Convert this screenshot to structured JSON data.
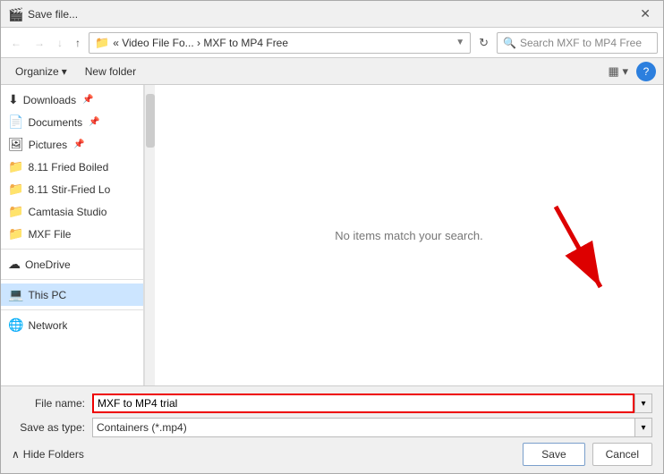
{
  "window": {
    "title": "Save file...",
    "icon": "🎬"
  },
  "nav": {
    "back_disabled": true,
    "forward_disabled": true,
    "up_disabled": false,
    "address_folder_icon": "📁",
    "address_path": "« Video File Fo... › MXF to MP4 Free",
    "address_dropdown_label": "▼",
    "refresh_label": "⟳",
    "search_placeholder": "Search MXF to MP4 Free"
  },
  "toolbar": {
    "organize_label": "Organize",
    "organize_arrow": "▾",
    "new_folder_label": "New folder",
    "view_icon": "▦",
    "view_arrow": "▾",
    "help_label": "?"
  },
  "sidebar": {
    "items": [
      {
        "id": "downloads",
        "icon": "⬇",
        "label": "Downloads",
        "pin": true
      },
      {
        "id": "documents",
        "icon": "📄",
        "label": "Documents",
        "pin": true
      },
      {
        "id": "pictures",
        "icon": "🖼",
        "label": "Pictures",
        "pin": true
      },
      {
        "id": "fried-boiled",
        "icon": "📁",
        "label": "8.11 Fried Boiled",
        "pin": false
      },
      {
        "id": "stir-fried",
        "icon": "📁",
        "label": "8.11 Stir-Fried Lo",
        "pin": false
      },
      {
        "id": "camtasia",
        "icon": "📁",
        "label": "Camtasia Studio",
        "pin": false
      },
      {
        "id": "mxf-file",
        "icon": "📁",
        "label": "MXF File",
        "pin": false
      },
      {
        "id": "onedrive",
        "icon": "☁",
        "label": "OneDrive",
        "pin": false
      },
      {
        "id": "this-pc",
        "icon": "💻",
        "label": "This PC",
        "pin": false
      },
      {
        "id": "network",
        "icon": "🌐",
        "label": "Network",
        "pin": false
      }
    ]
  },
  "content": {
    "empty_message": "No items match your search."
  },
  "bottom": {
    "filename_label": "File name:",
    "filename_value": "MXF to MP4 trial",
    "savetype_label": "Save as type:",
    "savetype_value": "Containers (*.mp4)",
    "hide_folders_label": "Hide Folders",
    "save_label": "Save",
    "cancel_label": "Cancel"
  }
}
